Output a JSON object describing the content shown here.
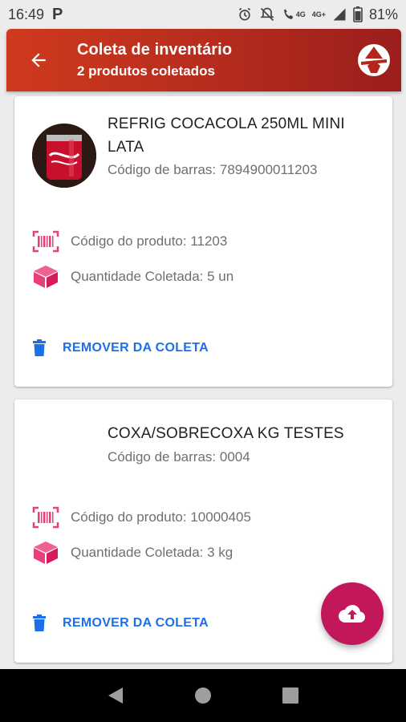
{
  "status_bar": {
    "time": "16:49",
    "notif_icon": "P",
    "network": "4G+",
    "network_small": "4G",
    "battery": "81%"
  },
  "app_bar": {
    "title": "Coleta de inventário",
    "subtitle": "2 produtos coletados"
  },
  "products": [
    {
      "name": "REFRIG COCACOLA 250ML MINI LATA",
      "barcode": "Código de barras: 7894900011203",
      "product_code": "Código do produto: 11203",
      "quantity": "Quantidade Coletada: 5 un",
      "remove_label": "REMOVER DA COLETA"
    },
    {
      "name": "COXA/SOBRECOXA KG TESTES",
      "barcode": "Código de barras: 0004",
      "product_code": "Código do produto: 10000405",
      "quantity": "Quantidade Coletada: 3 kg",
      "remove_label": "REMOVER DA COLETA"
    }
  ],
  "colors": {
    "app_bar": "#c0301c",
    "accent_icons": "#e83e7a",
    "link": "#1d6fe8",
    "fab": "#c2185b"
  }
}
